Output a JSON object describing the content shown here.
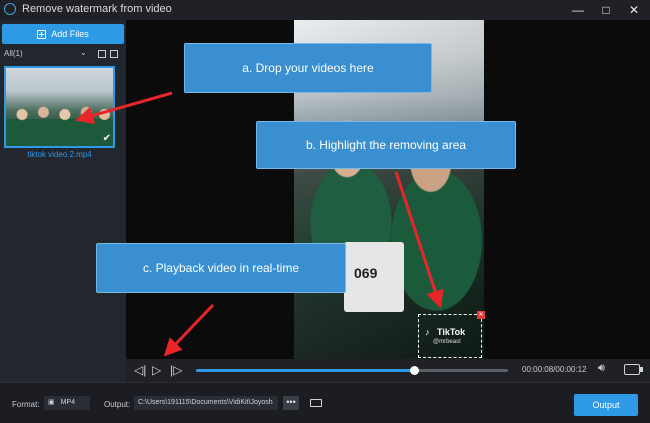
{
  "window": {
    "title": "Remove watermark from video",
    "controls": {
      "minimize": "—",
      "maximize": "□",
      "close": "✕"
    }
  },
  "sidebar": {
    "add_files_label": "Add Files",
    "filter_label": "All(1)",
    "files": [
      {
        "name": "tiktok video 2.mp4",
        "selected": true
      }
    ]
  },
  "callouts": [
    {
      "id": "a",
      "text": "a. Drop your videos here"
    },
    {
      "id": "b",
      "text": "b. Highlight the removing area"
    },
    {
      "id": "c",
      "text": "c. Playback video in real-time"
    }
  ],
  "video": {
    "tag_number": "069",
    "watermark_text": "TikTok",
    "watermark_handle": "@mrbeast"
  },
  "player": {
    "current_time": "00:00:08",
    "total_time": "00:00:12",
    "time_readout": "00:00:08/00:00:12",
    "progress": 0.7
  },
  "bottom_bar": {
    "format_label": "Format:",
    "format_value": "MP4",
    "output_label": "Output:",
    "output_path": "C:\\Users\\191115\\Documents\\VidiKit\\Joyosh",
    "browse_label": "•••",
    "output_button": "Output"
  },
  "colors": {
    "accent": "#2e9ae6",
    "callout": "#3a8fd0",
    "arrow": "#e8262a"
  }
}
